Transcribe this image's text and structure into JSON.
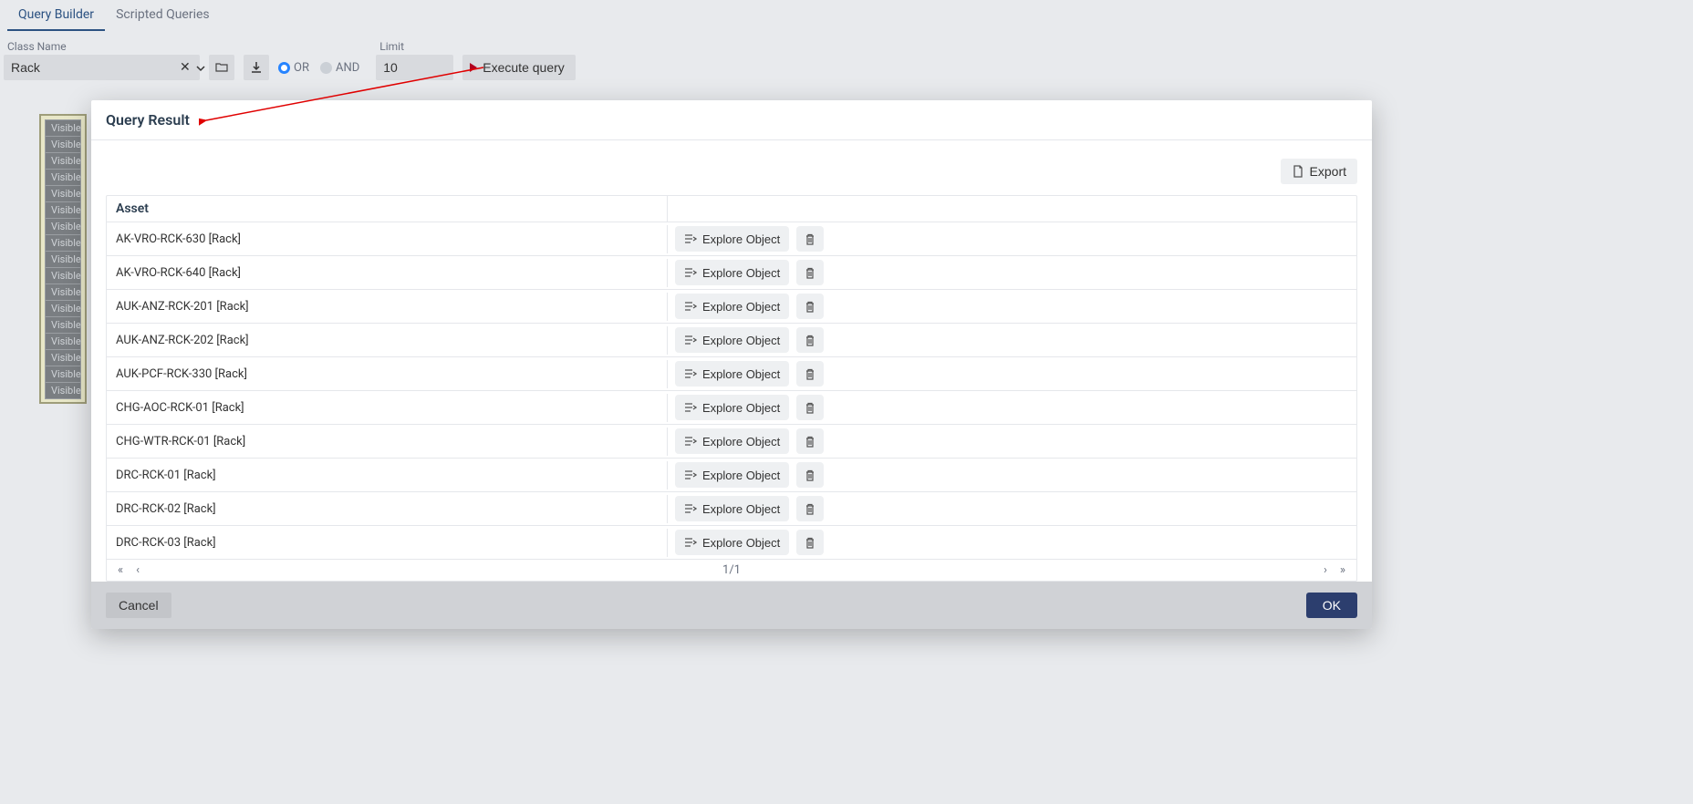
{
  "tabs": {
    "builder": "Query Builder",
    "scripted": "Scripted Queries"
  },
  "toolbar": {
    "classNameLabel": "Class Name",
    "classNameValue": "Rack",
    "orLabel": "OR",
    "andLabel": "AND",
    "limitLabel": "Limit",
    "limitValue": "10",
    "executeLabel": "Execute query"
  },
  "visibleLabel": "Visible",
  "visibleCount": 17,
  "modal": {
    "title": "Query Result",
    "exportLabel": "Export",
    "assetHeader": "Asset",
    "exploreLabel": "Explore Object",
    "pageInfo": "1/1",
    "cancelLabel": "Cancel",
    "okLabel": "OK"
  },
  "results": [
    "AK-VRO-RCK-630 [Rack]",
    "AK-VRO-RCK-640 [Rack]",
    "AUK-ANZ-RCK-201 [Rack]",
    "AUK-ANZ-RCK-202 [Rack]",
    "AUK-PCF-RCK-330 [Rack]",
    "CHG-AOC-RCK-01 [Rack]",
    "CHG-WTR-RCK-01 [Rack]",
    "DRC-RCK-01 [Rack]",
    "DRC-RCK-02 [Rack]",
    "DRC-RCK-03 [Rack]"
  ]
}
